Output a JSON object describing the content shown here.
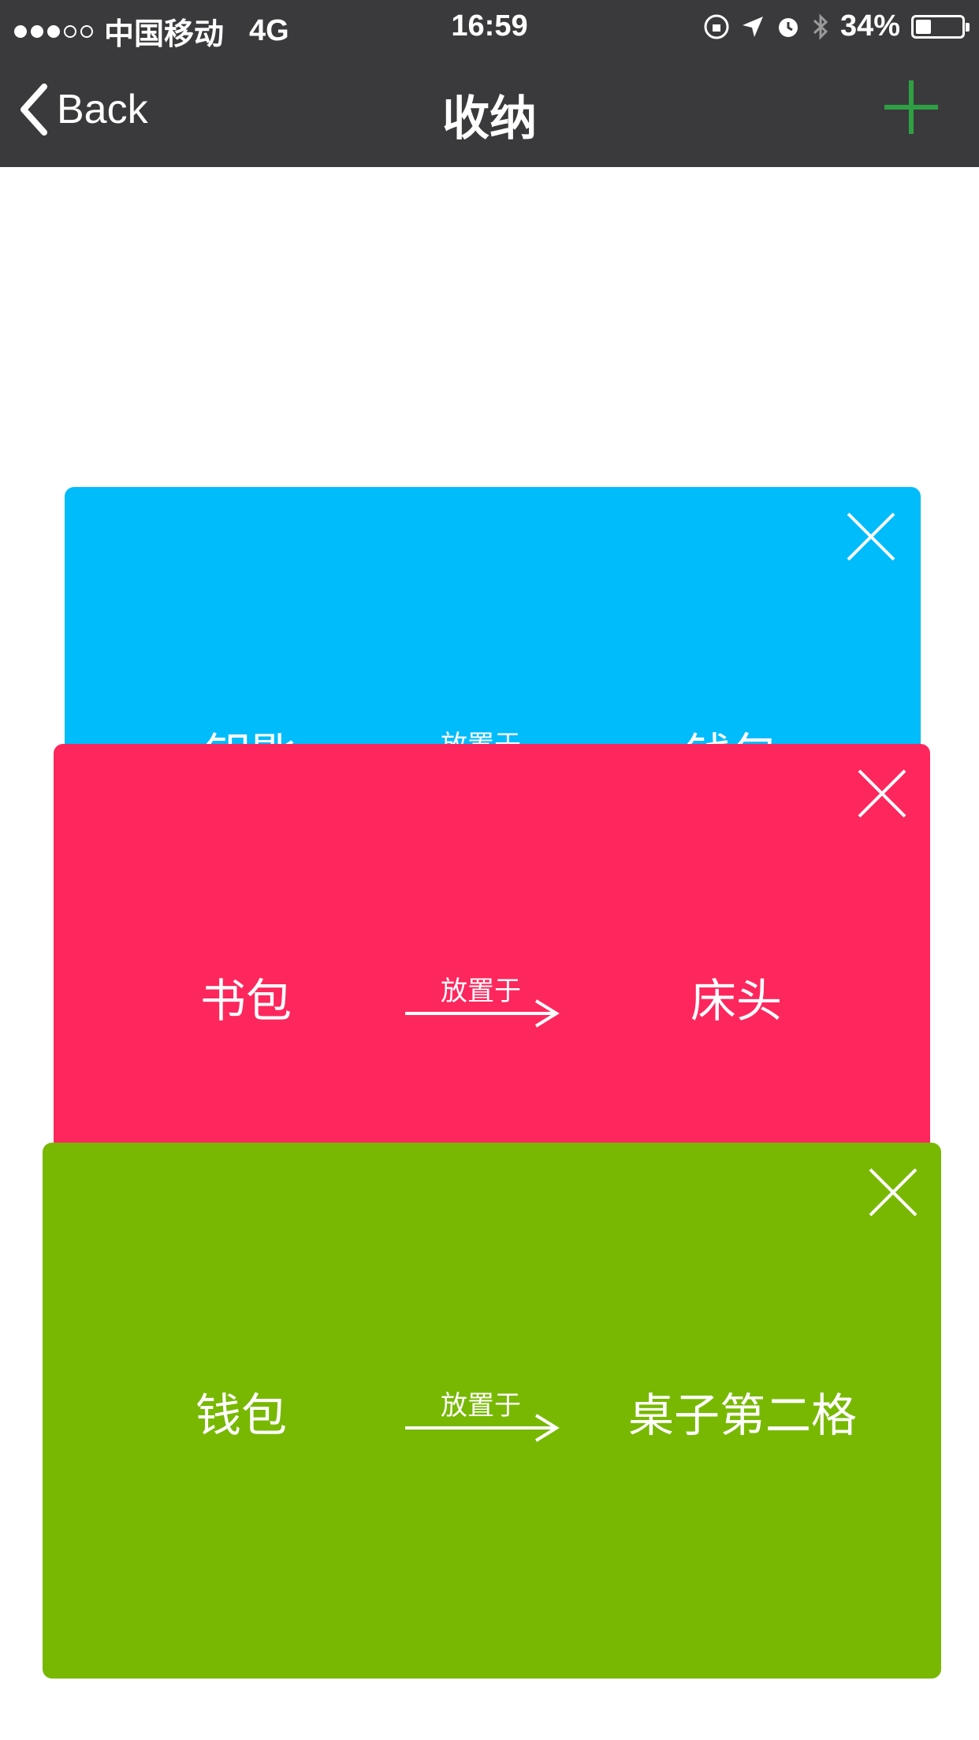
{
  "status_bar": {
    "carrier": "中国移动",
    "network": "4G",
    "time": "16:59",
    "battery": "34%",
    "battery_level": 0.34,
    "signal_bars_filled": 3,
    "signal_bars_total": 5
  },
  "nav": {
    "back_label": "Back",
    "title": "收纳",
    "add_icon": "plus-icon",
    "add_color": "#2ea043"
  },
  "cards": [
    {
      "color": "#00bcfb",
      "item": "钥匙",
      "relation": "放置于",
      "location": "钱包"
    },
    {
      "color": "#fd275d",
      "item": "书包",
      "relation": "放置于",
      "location": "床头"
    },
    {
      "color": "#78b803",
      "item": "钱包",
      "relation": "放置于",
      "location": "桌子第二格"
    }
  ]
}
